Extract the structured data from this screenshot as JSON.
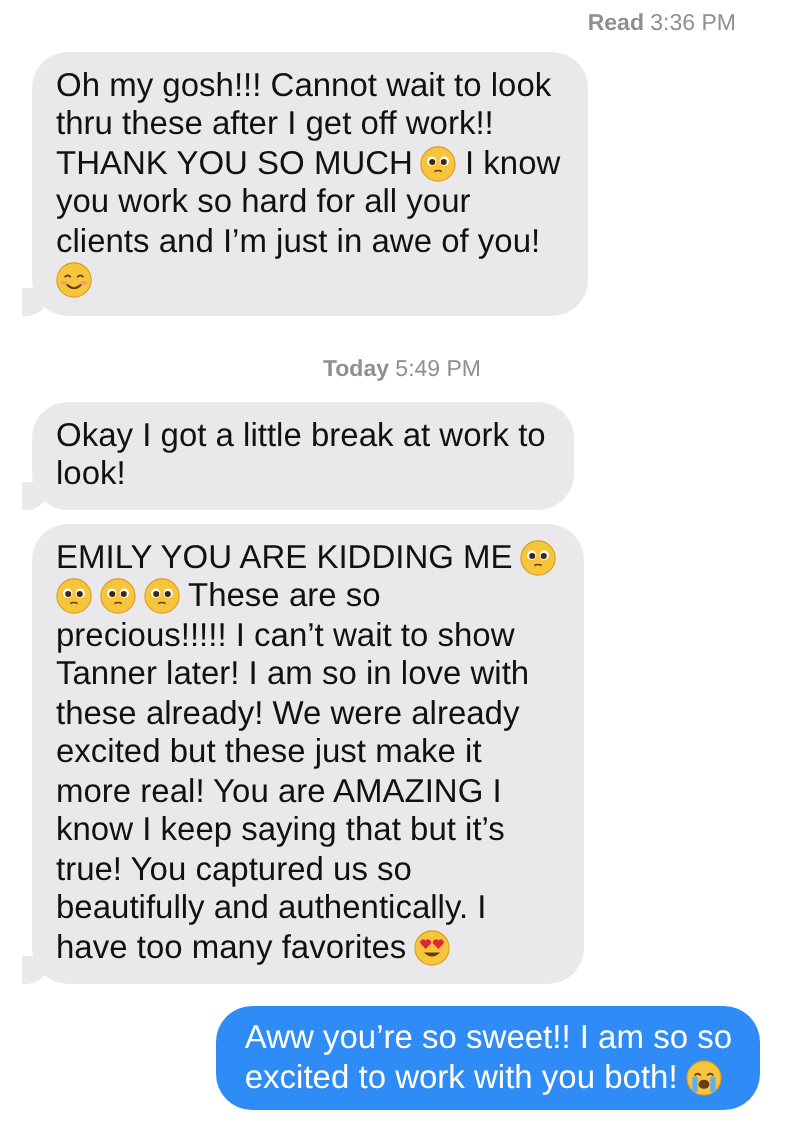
{
  "items": [
    {
      "kind": "status",
      "text": "**Read** 3:36 PM"
    },
    {
      "kind": "received",
      "lines": [
        [
          {
            "kind": "text",
            "text": "Oh my gosh!!! Cannot wait to look"
          }
        ],
        [
          {
            "kind": "text",
            "text": "thru these after I get off work!!"
          }
        ],
        [
          {
            "kind": "text",
            "text": "THANK YOU SO MUCH"
          },
          {
            "kind": "pleading"
          },
          {
            "kind": "text",
            "text": "I know"
          }
        ],
        [
          {
            "kind": "text",
            "text": "you work so hard for all your"
          }
        ],
        [
          {
            "kind": "text",
            "text": "clients and I’m just in awe of you!"
          }
        ],
        [
          {
            "kind": "smile"
          }
        ]
      ]
    },
    {
      "kind": "timestamp",
      "text": "**Today** 5:49 PM"
    },
    {
      "kind": "received",
      "lines": [
        [
          {
            "kind": "text",
            "text": "Okay I got a little break at work to"
          }
        ],
        [
          {
            "kind": "text",
            "text": "look!"
          }
        ]
      ]
    },
    {
      "kind": "received",
      "lines": [
        [
          {
            "kind": "text",
            "text": "EMILY YOU ARE KIDDING ME"
          },
          {
            "kind": "pleading"
          }
        ],
        [
          {
            "kind": "pleading"
          },
          {
            "kind": "pleading"
          },
          {
            "kind": "pleading"
          },
          {
            "kind": "text",
            "text": "These are so"
          }
        ],
        [
          {
            "kind": "text",
            "text": "precious!!!!! I can’t wait to show"
          }
        ],
        [
          {
            "kind": "text",
            "text": "Tanner later! I am so in love with"
          }
        ],
        [
          {
            "kind": "text",
            "text": "these already! We were already"
          }
        ],
        [
          {
            "kind": "text",
            "text": "excited but these just make it"
          }
        ],
        [
          {
            "kind": "text",
            "text": "more real! You are AMAZING I"
          }
        ],
        [
          {
            "kind": "text",
            "text": "know I keep saying that but it’s"
          }
        ],
        [
          {
            "kind": "text",
            "text": "true! You captured us so"
          }
        ],
        [
          {
            "kind": "text",
            "text": "beautifully and authentically. I"
          }
        ],
        [
          {
            "kind": "text",
            "text": "have too many favorites"
          },
          {
            "kind": "heart-eyes"
          }
        ]
      ]
    },
    {
      "kind": "sent",
      "lines": [
        [
          {
            "kind": "text",
            "text": "Aww you’re so sweet!! I am so so"
          }
        ],
        [
          {
            "kind": "text",
            "text": "excited to work with you both!"
          },
          {
            "kind": "crying"
          }
        ]
      ]
    }
  ]
}
